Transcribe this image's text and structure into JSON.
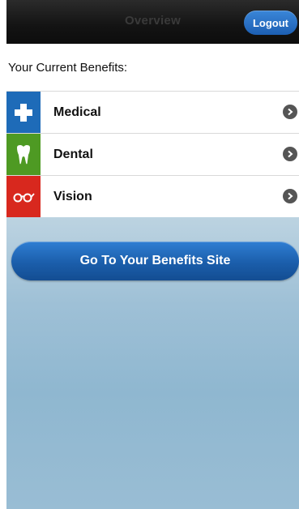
{
  "header": {
    "title": "Overview",
    "logout_label": "Logout"
  },
  "benefits_heading": "Your Current Benefits:",
  "benefits": [
    {
      "label": "Medical",
      "icon": "medical-cross-icon",
      "color": "#1e6bb8"
    },
    {
      "label": "Dental",
      "icon": "tooth-icon",
      "color": "#4e9a23"
    },
    {
      "label": "Vision",
      "icon": "glasses-icon",
      "color": "#d8281e"
    }
  ],
  "cta": {
    "label": "Go To Your Benefits Site"
  },
  "colors": {
    "topbar": "#131313",
    "button_blue": "#1b5eab",
    "background_blue": "#9ec0d6"
  }
}
